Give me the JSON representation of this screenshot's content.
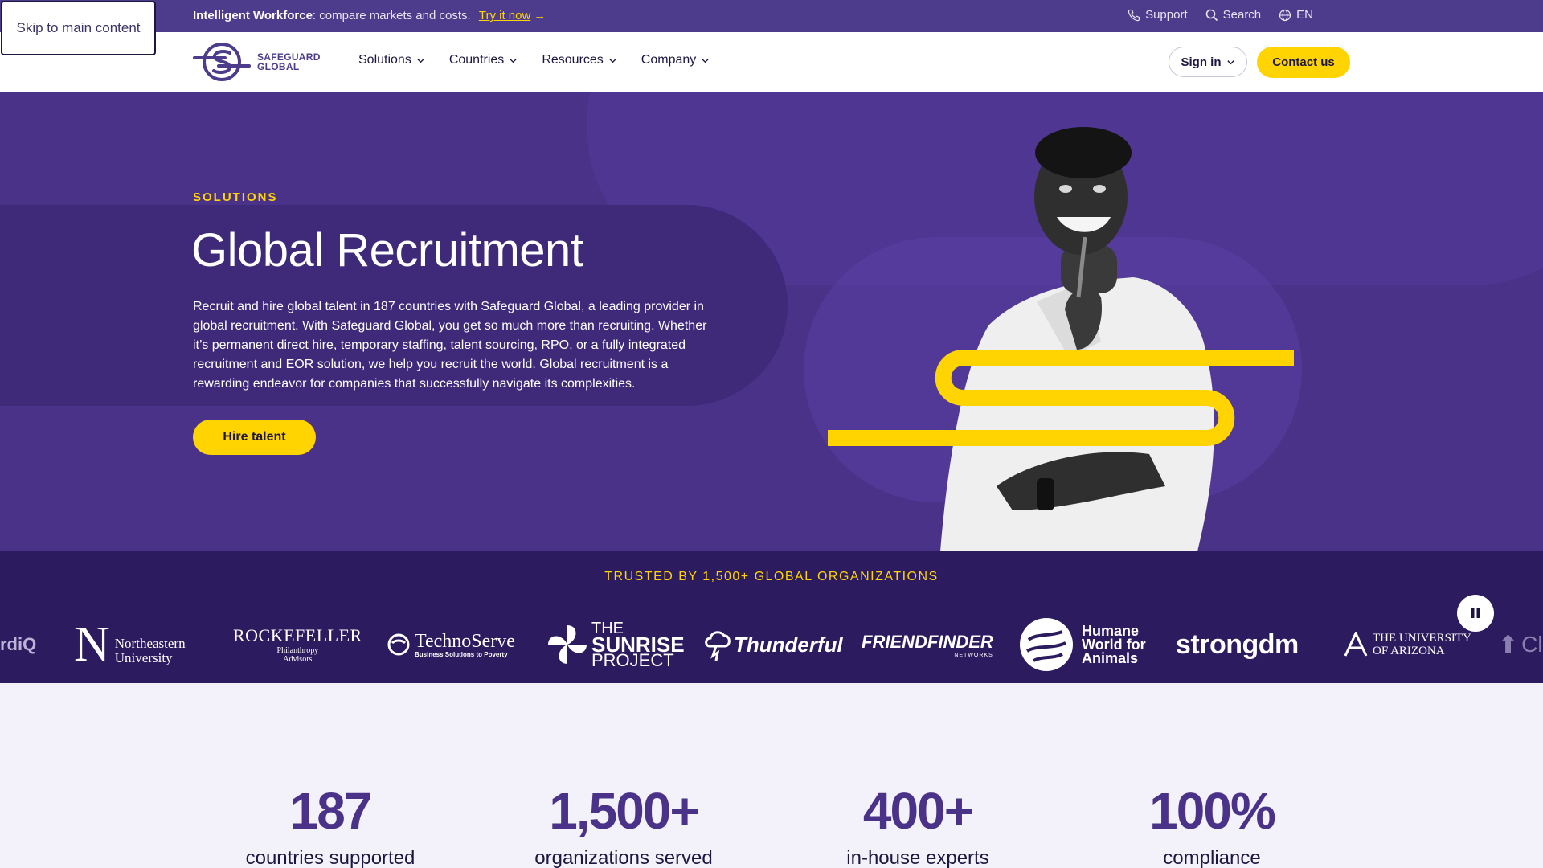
{
  "skip_link": "Skip to main content",
  "topbar": {
    "promo_bold": "Intelligent Workforce",
    "promo_text": ": compare markets and costs.",
    "promo_link": "Try it now",
    "support": "Support",
    "search": "Search",
    "language": "EN"
  },
  "header": {
    "logo_line1": "SAFEGUARD",
    "logo_line2": "GLOBAL",
    "nav": [
      "Solutions",
      "Countries",
      "Resources",
      "Company"
    ],
    "signin": "Sign in",
    "contact": "Contact us"
  },
  "hero": {
    "eyebrow": "SOLUTIONS",
    "title": "Global Recruitment",
    "description": "Recruit and hire global talent in 187 countries with Safeguard Global, a leading provider in global recruitment. With Safeguard Global, you get so much more than recruiting. Whether it’s permanent direct hire, temporary staffing, talent sourcing, RPO, or a fully integrated recruitment and EOR solution, we help you recruit the world. Global recruitment is a rewarding endeavor for companies that successfully navigate its complexities.",
    "cta": "Hire talent"
  },
  "trust": {
    "label": "TRUSTED BY 1,500+ GLOBAL ORGANIZATIONS",
    "logos": {
      "cliq": "rdiQ",
      "northeastern_1": "Northeastern",
      "northeastern_2": "University",
      "rockefeller_1": "ROCKEFELLER",
      "rockefeller_2": "Philanthropy",
      "rockefeller_3": "Advisors",
      "technoserve_1": "TechnoServe",
      "technoserve_2": "Business Solutions to Poverty",
      "sunrise_1": "THE",
      "sunrise_2": "SUNRISE",
      "sunrise_3": "PROJECT",
      "thunderful": "Thunderful",
      "friendfinder_1": "FRIENDFINDER",
      "friendfinder_2": "NETWORKS",
      "humane_1": "Humane",
      "humane_2": "World for",
      "humane_3": "Animals",
      "strongdm": "strongdm",
      "arizona_1": "THE UNIVERSITY",
      "arizona_2": "OF ARIZONA",
      "cut": "Clo"
    }
  },
  "stats": [
    {
      "num": "187",
      "cap": "countries supported"
    },
    {
      "num": "1,500+",
      "cap": "organizations served"
    },
    {
      "num": "400+",
      "cap": "in-house experts"
    },
    {
      "num": "100%",
      "cap": "compliance"
    }
  ],
  "colors": {
    "brand_purple": "#4a3288",
    "topbar_purple": "#4d3c8c",
    "dark_band": "#2c1b5e",
    "accent_yellow": "#ffd400"
  },
  "icons": [
    "phone-icon",
    "search-icon",
    "globe-icon",
    "chevron-down-icon",
    "arrow-right-icon",
    "pause-icon"
  ]
}
